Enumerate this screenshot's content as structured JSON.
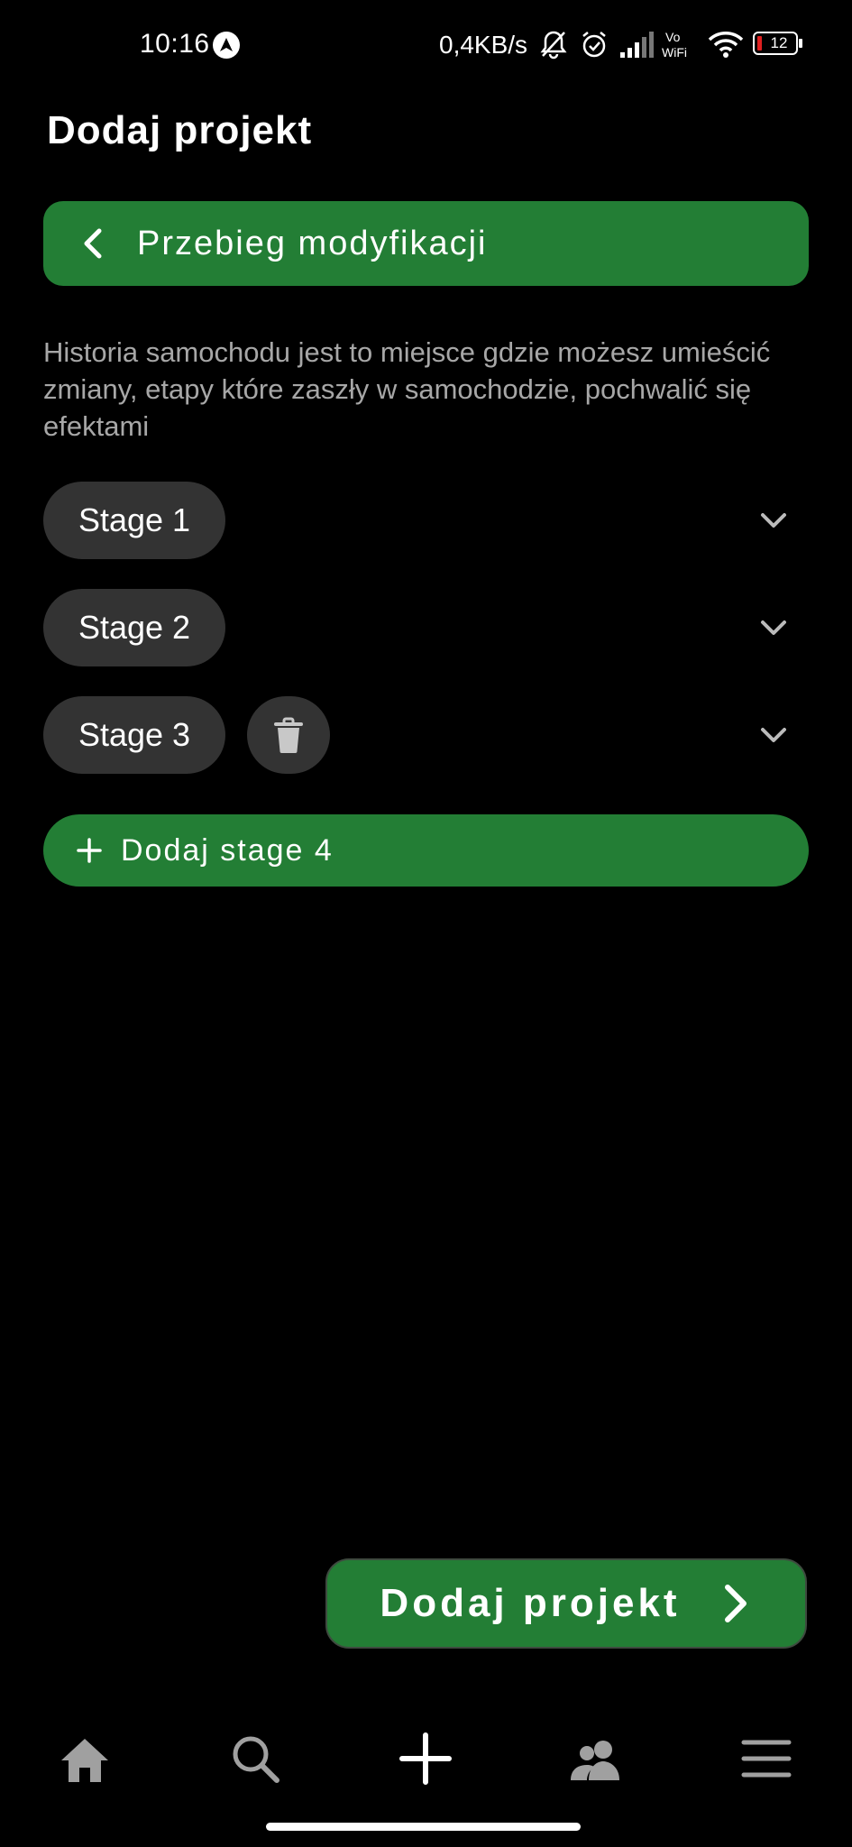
{
  "status_bar": {
    "time": "10:16",
    "network_speed": "0,4KB/s",
    "battery_level": "12"
  },
  "header": {
    "title": "Dodaj projekt"
  },
  "section": {
    "title": "Przebieg modyfikacji",
    "description": "Historia samochodu jest to miejsce gdzie możesz umieścić zmiany, etapy które zaszły w samochodzie, pochwalić się efektami"
  },
  "stages": [
    {
      "label": "Stage 1"
    },
    {
      "label": "Stage 2"
    },
    {
      "label": "Stage 3"
    }
  ],
  "add_stage_label": "Dodaj stage 4",
  "primary_button": {
    "label": "Dodaj projekt"
  },
  "bottom_nav": {
    "items": [
      {
        "icon": "home-icon"
      },
      {
        "icon": "search-icon"
      },
      {
        "icon": "plus-icon"
      },
      {
        "icon": "people-icon"
      },
      {
        "icon": "menu-icon"
      }
    ]
  },
  "colors": {
    "accent_green": "#237e35",
    "pill_gray": "#333333",
    "description_gray": "#a7a7a7",
    "background": "#000000"
  }
}
